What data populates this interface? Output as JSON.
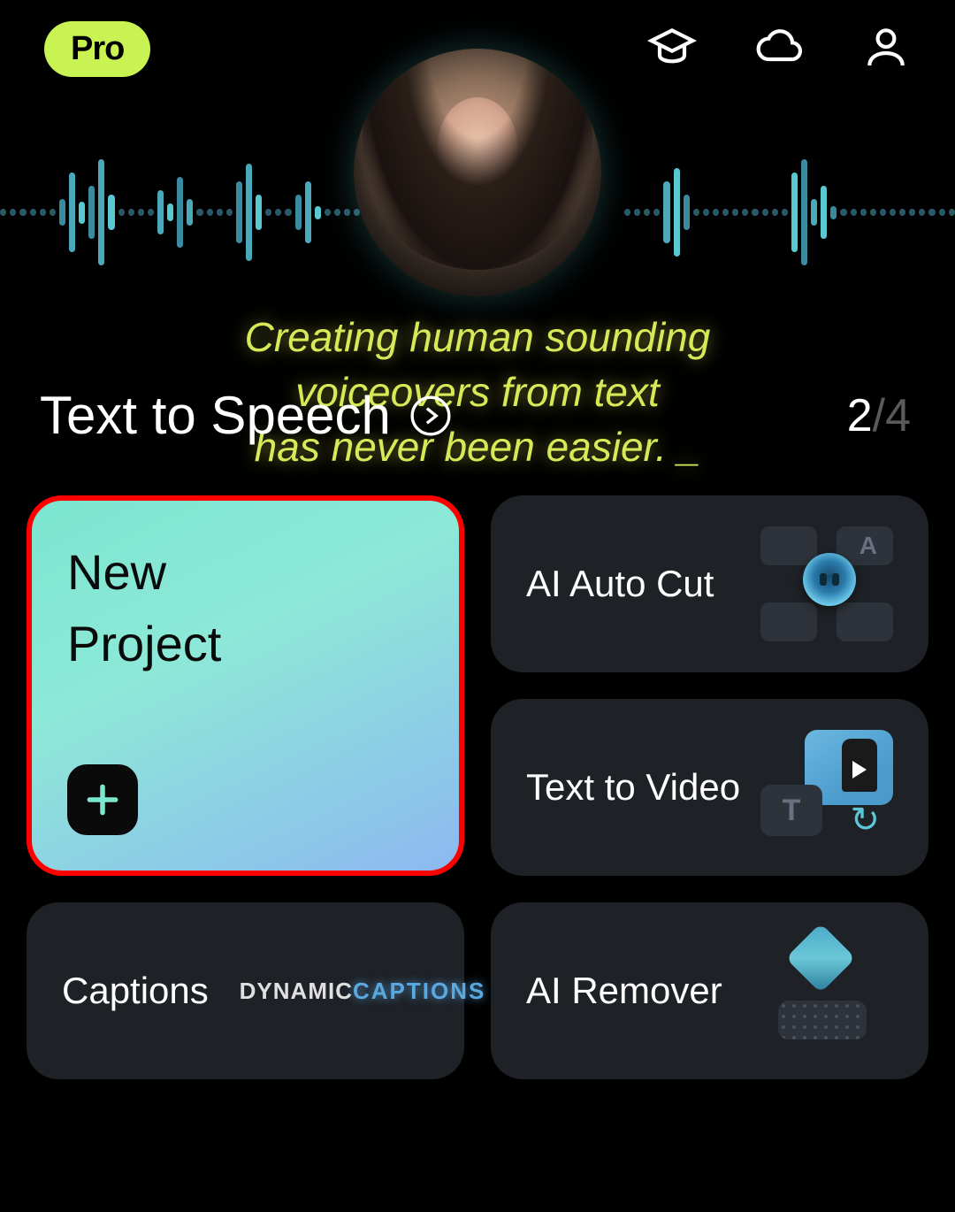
{
  "header": {
    "pro_label": "Pro"
  },
  "hero": {
    "tagline_line1": "Creating human sounding",
    "tagline_line2": "voiceovers from text",
    "tagline_line3": "has never been easier. _",
    "feature_title": "Text to Speech",
    "counter_current": "2",
    "counter_sep": "/",
    "counter_total": "4"
  },
  "cards": {
    "new_project": "New Project",
    "ai_auto_cut": "AI Auto Cut",
    "text_to_video": "Text to Video",
    "captions": "Captions",
    "ai_remover": "AI Remover",
    "captions_thumb_l1": "DYNAMIC",
    "captions_thumb_l2": "CAPTIONS",
    "ttv_thumb_letter": "T",
    "autocut_letter": "A"
  }
}
